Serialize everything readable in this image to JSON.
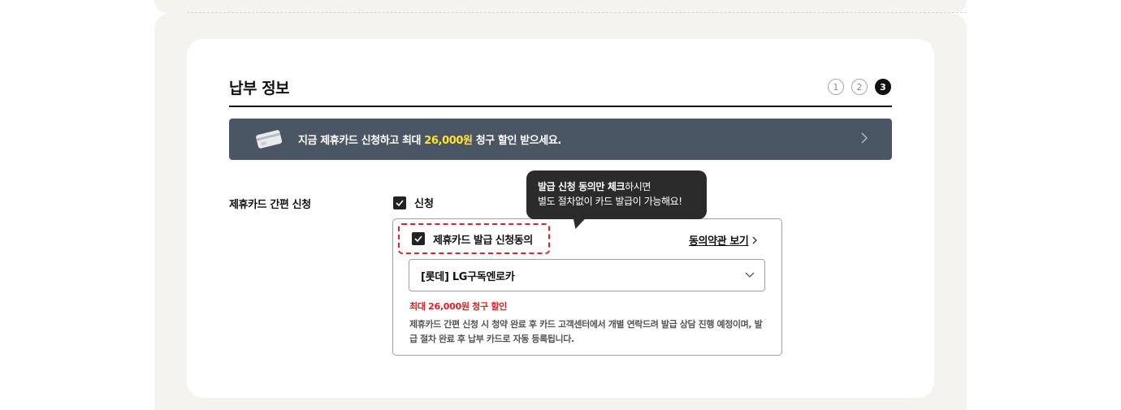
{
  "section": {
    "title": "납부 정보",
    "steps": [
      "1",
      "2",
      "3"
    ],
    "active_step": "3"
  },
  "banner": {
    "text_before": "지금 제휴카드 신청하고 최대 ",
    "highlight": "26,000원",
    "text_after": " 청구 할인 받으세요.",
    "icon": "credit-card-icon",
    "highlight_color": "#ffe32e"
  },
  "card_apply": {
    "label": "제휴카드 간편 신청",
    "checkbox_label": "신청",
    "checked": true
  },
  "tooltip": {
    "line1_bold_1": "발급 신청 동의만 ",
    "line1_bold_2": "체크",
    "line1_rest": "하시면",
    "line2": "별도 절차없이 카드 발급이 가능해요!"
  },
  "consent": {
    "label": "제휴카드 발급 신청동의",
    "checked": true,
    "terms_link": "동의약관 보기",
    "border_color": "#d8232a"
  },
  "card_select": {
    "value": "[롯데]  LG구독엔로카"
  },
  "discount_note": "최대 26,000원 청구 할인",
  "notice": "제휴카드 간편 신청 시 청약 완료 후 카드 고객센터에서 개별 연락드려 발급 상담 진행 예정이며, 발급 절차 완료 후 납부 카드로 자동 등록됩니다."
}
